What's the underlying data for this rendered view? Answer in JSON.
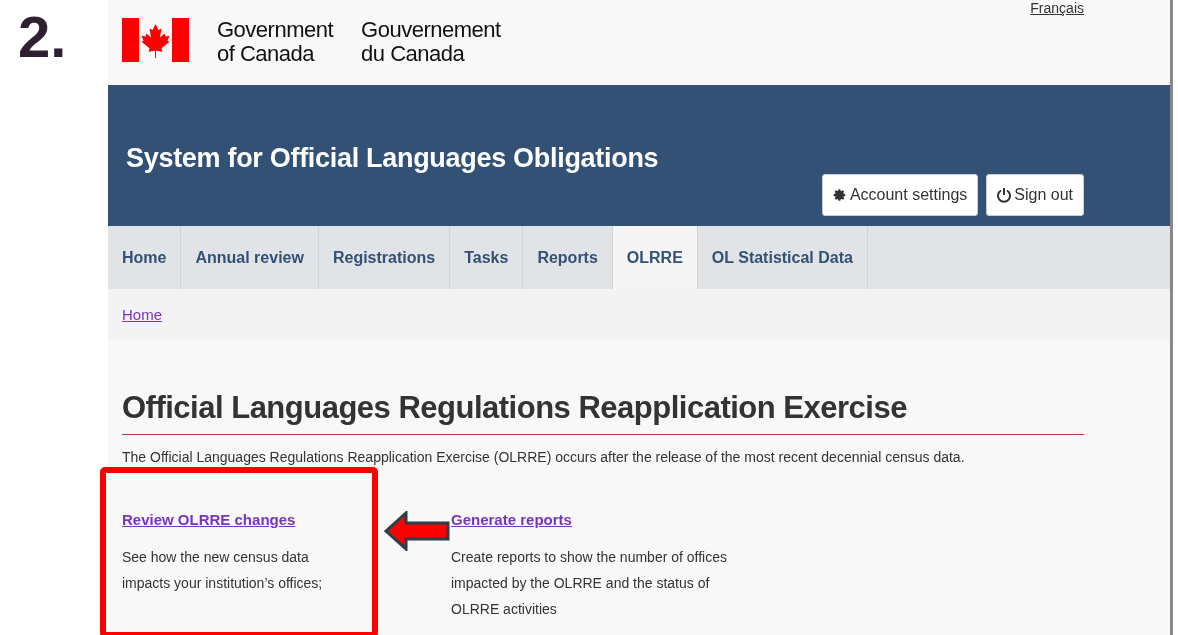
{
  "step_label": "2.",
  "header": {
    "lang_link": "Français",
    "gov_en": [
      "Government",
      "of Canada"
    ],
    "gov_fr": [
      "Gouvernement",
      "du Canada"
    ]
  },
  "banner": {
    "title": "System for Official Languages Obligations",
    "buttons": [
      {
        "kind": "settings",
        "label": "Account settings"
      },
      {
        "kind": "power",
        "label": "Sign out"
      }
    ]
  },
  "nav": [
    {
      "label": "Home",
      "selected": false
    },
    {
      "label": "Annual review",
      "selected": false
    },
    {
      "label": "Registrations",
      "selected": false
    },
    {
      "label": "Tasks",
      "selected": false
    },
    {
      "label": "Reports",
      "selected": false
    },
    {
      "label": "OLRRE",
      "selected": true
    },
    {
      "label": "OL Statistical Data",
      "selected": false
    }
  ],
  "breadcrumb": [
    "Home"
  ],
  "heading": "Official Languages Regulations Reapplication Exercise",
  "intro": "The Official Languages Regulations Reapplication Exercise (OLRRE) occurs after the release of the most recent decennial census data.",
  "cards": [
    {
      "link": "Review OLRRE changes",
      "text": "See how the new census data impacts your institution’s offices;",
      "highlighted": true
    },
    {
      "link": "Generate reports",
      "text": "Create reports to show the number of offices impacted by the OLRRE and the status of OLRRE activities",
      "highlighted": false
    }
  ]
}
